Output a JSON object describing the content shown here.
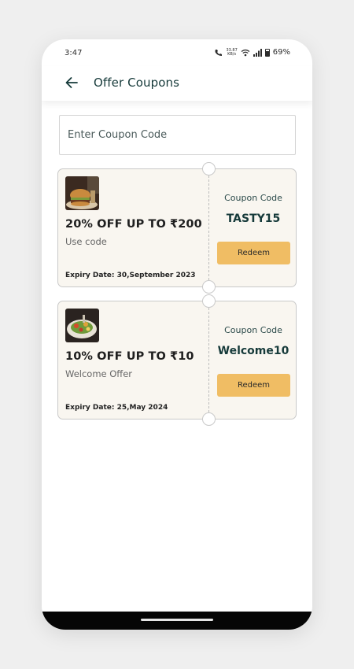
{
  "status_bar": {
    "time": "3:47",
    "net_speed_top": "33.87",
    "net_speed_bottom": "KB/s",
    "battery": "69%",
    "icons": [
      "wifi-calling-icon",
      "wifi-icon",
      "signal-icon",
      "battery-icon"
    ]
  },
  "header": {
    "title": "Offer Coupons",
    "back_icon": "arrow-left-icon"
  },
  "coupon_input": {
    "placeholder": "Enter Coupon Code",
    "value": ""
  },
  "coupons": [
    {
      "title": "20% OFF UP TO ₹200",
      "subtitle": "Use code",
      "expiry": "Expiry Date: 30,September 2023",
      "code_label": "Coupon Code",
      "code": "TASTY15",
      "button_label": "Redeem",
      "image": "burger-food-image"
    },
    {
      "title": "10% OFF UP TO ₹10",
      "subtitle": "Welcome Offer",
      "expiry": "Expiry Date: 25,May 2024",
      "code_label": "Coupon Code",
      "code": "Welcome10",
      "button_label": "Redeem",
      "image": "salad-food-image"
    }
  ],
  "colors": {
    "accent_button": "#f0bd64",
    "card_background": "#f9f6f0",
    "title_text": "#163a3a"
  }
}
